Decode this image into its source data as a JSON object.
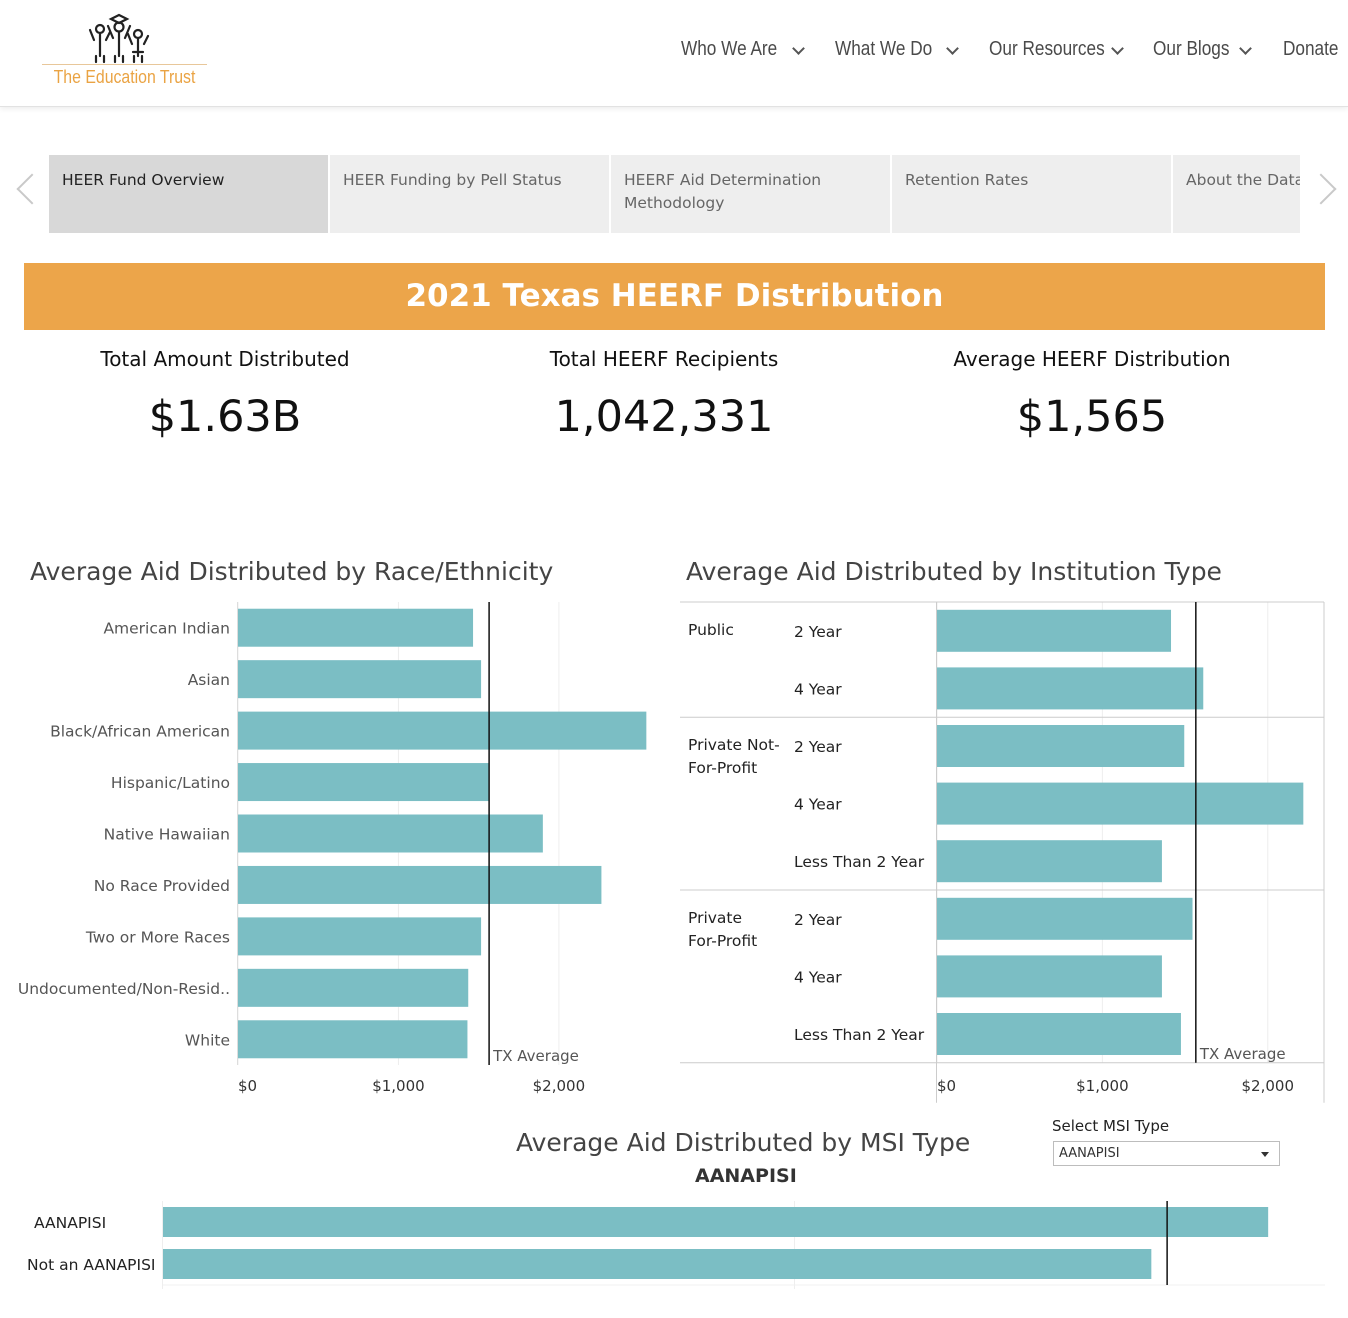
{
  "header": {
    "logo_text": "The Education Trust",
    "nav": [
      {
        "label": "Who We Are"
      },
      {
        "label": "What We Do"
      },
      {
        "label": "Our Resources"
      },
      {
        "label": "Our Blogs"
      },
      {
        "label": "Donate"
      }
    ]
  },
  "tabs": [
    {
      "label": "HEER Fund Overview",
      "active": true
    },
    {
      "label": "HEER Funding by Pell Status",
      "active": false
    },
    {
      "label": "HEERF Aid Determination Methodology",
      "active": false
    },
    {
      "label": "Retention Rates",
      "active": false
    },
    {
      "label": "About the Data",
      "active": false
    }
  ],
  "banner": {
    "title": "2021 Texas HEERF Distribution"
  },
  "kpis": [
    {
      "label": "Total Amount Distributed",
      "value": "$1.63B"
    },
    {
      "label": "Total HEERF Recipients",
      "value": "1,042,331"
    },
    {
      "label": "Average HEERF Distribution",
      "value": "$1,565"
    }
  ],
  "colors": {
    "bar": "#7bbec4",
    "banner": "#eca54a",
    "logo": "#eaa343"
  },
  "chart_data": [
    {
      "type": "bar",
      "orientation": "horizontal",
      "title": "Average Aid Distributed by Race/Ethnicity",
      "categories": [
        "American Indian",
        "Asian",
        "Black/African American",
        "Hispanic/Latino",
        "Native Hawaiian",
        "No Race Provided",
        "Two or More Races",
        "Undocumented/Non-Resid..",
        "White"
      ],
      "values": [
        1465,
        1515,
        2545,
        1565,
        1900,
        2265,
        1515,
        1435,
        1430
      ],
      "reference_line": {
        "label": "TX Average",
        "value": 1565
      },
      "xticks": [
        "$0",
        "$1,000",
        "$2,000"
      ],
      "xtick_values": [
        0,
        1000,
        2000
      ],
      "xlim": [
        0,
        2680
      ],
      "grid": true
    },
    {
      "type": "bar",
      "orientation": "horizontal",
      "title": "Average Aid Distributed by Institution Type",
      "groups": [
        {
          "name": "Public",
          "rows": [
            {
              "label": "2 Year",
              "value": 1415
            },
            {
              "label": "4 Year",
              "value": 1610
            }
          ]
        },
        {
          "name": "Private Not-For-Profit",
          "rows": [
            {
              "label": "2 Year",
              "value": 1495
            },
            {
              "label": "4 Year",
              "value": 2215
            },
            {
              "label": "Less Than 2 Year",
              "value": 1360
            }
          ]
        },
        {
          "name": "Private For-Profit",
          "rows": [
            {
              "label": "2 Year",
              "value": 1545
            },
            {
              "label": "4 Year",
              "value": 1360
            },
            {
              "label": "Less Than 2 Year",
              "value": 1475
            }
          ]
        }
      ],
      "reference_line": {
        "label": "TX Average",
        "value": 1565
      },
      "xticks": [
        "$0",
        "$1,000",
        "$2,000"
      ],
      "xtick_values": [
        0,
        1000,
        2000
      ],
      "xlim": [
        0,
        2340
      ],
      "grid": true
    },
    {
      "type": "bar",
      "orientation": "horizontal",
      "title": "Average Aid Distributed by MSI Type",
      "subtitle": "AANAPISI",
      "categories": [
        "AANAPISI",
        "Not an AANAPISI"
      ],
      "values": [
        1750,
        1565
      ],
      "reference_line": {
        "value": 1590
      },
      "xlim": [
        0,
        1840
      ],
      "grid": true
    }
  ],
  "msi_filter": {
    "label": "Select MSI Type",
    "selected": "AANAPISI"
  }
}
